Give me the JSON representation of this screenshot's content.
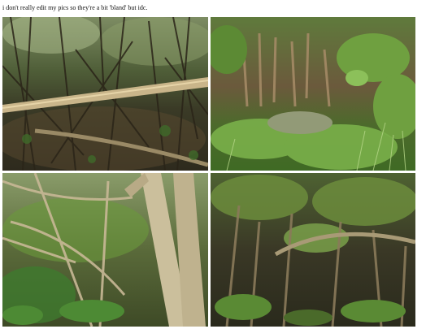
{
  "post": {
    "caption": "i don't really edit my pics so they're a bit 'bland' but idc."
  }
}
